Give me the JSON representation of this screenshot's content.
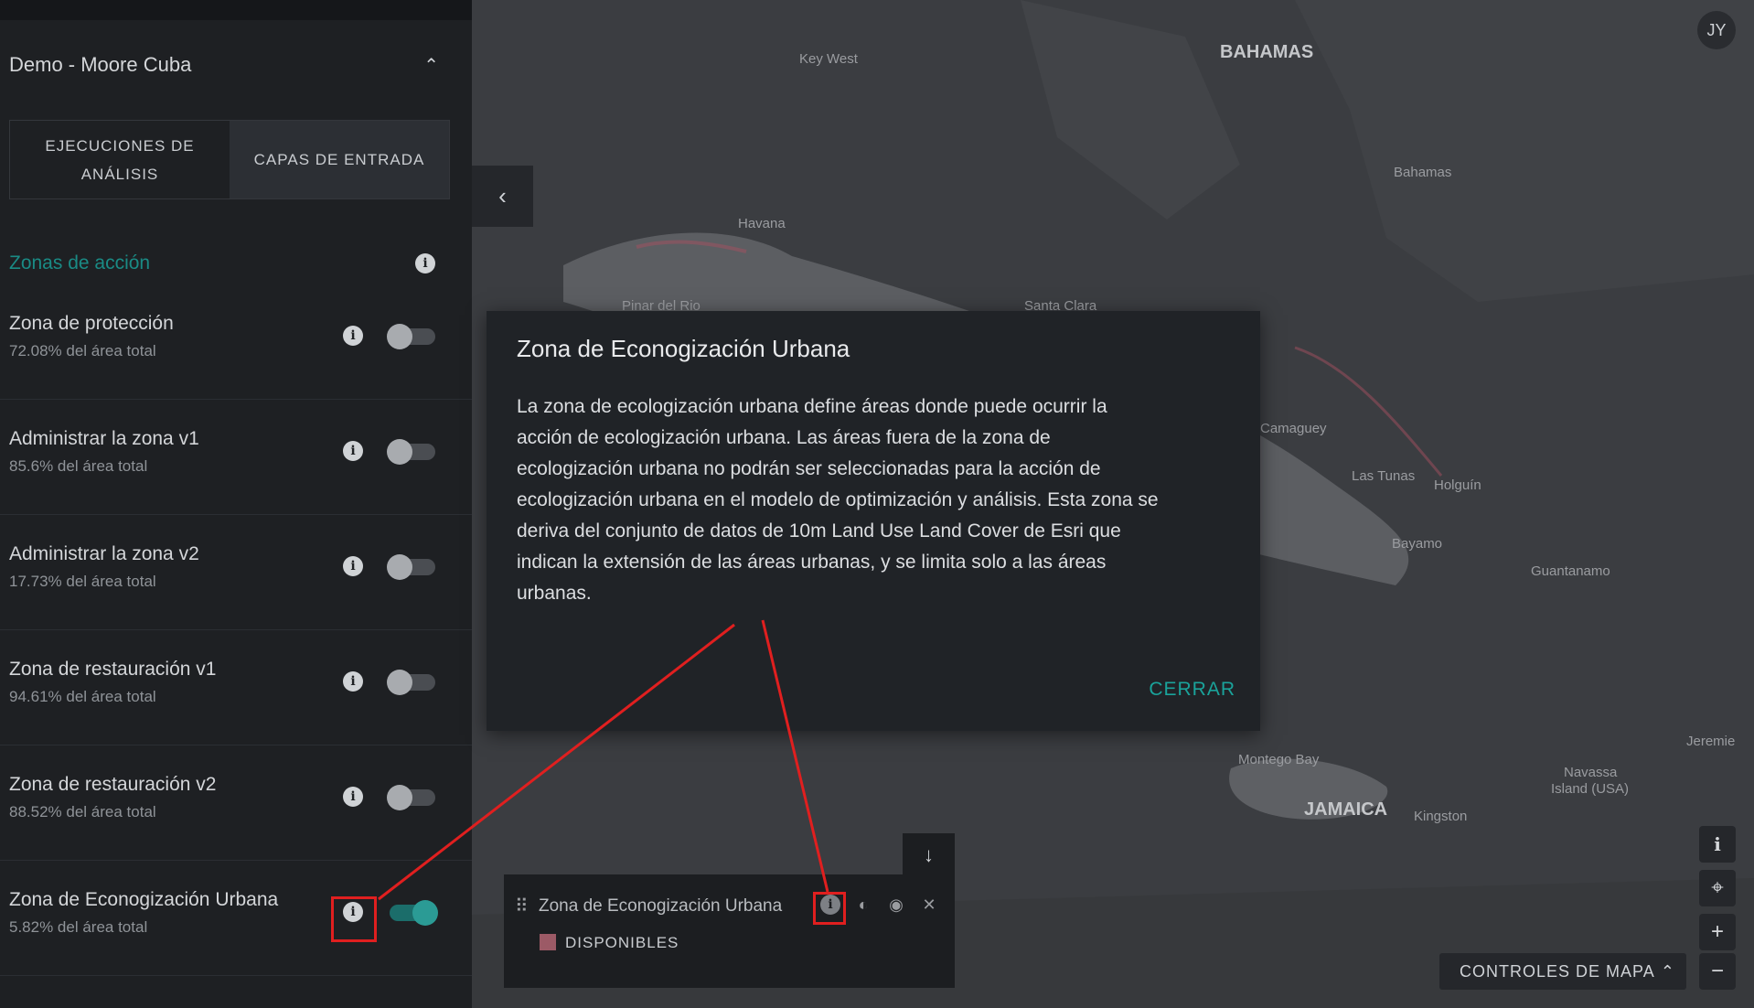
{
  "project": {
    "title": "Demo - Moore Cuba"
  },
  "tabs": [
    {
      "label_line1": "EJECUCIONES DE",
      "label_line2": "ANÁLISIS",
      "active": false
    },
    {
      "label": "CAPAS DE ENTRADA",
      "active": true
    }
  ],
  "section": {
    "title": "Zonas de acción"
  },
  "layers": [
    {
      "name": "Zona de protección",
      "sub": "72.08% del área total",
      "enabled": false
    },
    {
      "name": "Administrar la zona v1",
      "sub": "85.6% del área total",
      "enabled": false
    },
    {
      "name": "Administrar la zona v2",
      "sub": "17.73% del área total",
      "enabled": false
    },
    {
      "name": "Zona de restauración v1",
      "sub": "94.61% del área total",
      "enabled": false
    },
    {
      "name": "Zona de restauración v2",
      "sub": "88.52% del área total",
      "enabled": false
    },
    {
      "name": "Zona de Econogización Urbana",
      "sub": "5.82% del área total",
      "enabled": true
    }
  ],
  "map": {
    "labels": [
      "Key West",
      "BAHAMAS",
      "Bahamas",
      "Havana",
      "Pinar del Rio",
      "Santa Clara",
      "Camaguey",
      "Las Tunas",
      "Holguín",
      "Bayamo",
      "Guantanamo",
      "Montego Bay",
      "JAMAICA",
      "Kingston",
      "Navassa",
      "Island (USA)",
      "Jeremie"
    ]
  },
  "user": {
    "initials": "JY"
  },
  "modal": {
    "title": "Zona de Econogización Urbana",
    "body_lines": [
      "La zona de ecologización urbana define áreas donde puede ocurrir la",
      "acción de ecologización urbana. Las áreas fuera de la zona de",
      "ecologización urbana no podrán ser seleccionadas para la acción de",
      "ecologización urbana en el modelo de optimización y análisis. Esta zona se",
      "deriva del conjunto de datos de 10m Land Use Land Cover de Esri que",
      "indican la extensión de las áreas urbanas, y se limita solo a las áreas",
      "urbanas."
    ],
    "close_label": "CERRAR"
  },
  "legend": {
    "title": "Zona de Econogización Urbana",
    "category": "DISPONIBLES",
    "swatch_color": "#9c5a66"
  },
  "map_controls": {
    "label": "CONTROLES DE MAPA"
  },
  "colors": {
    "accent": "#1a8b85",
    "highlight": "#e01f1f"
  }
}
